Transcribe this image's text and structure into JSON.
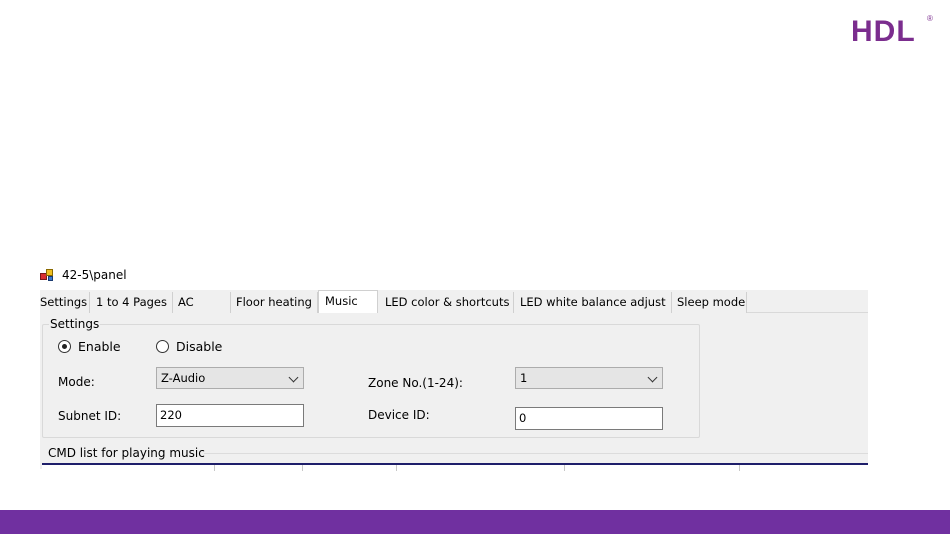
{
  "brand": {
    "logo_text": "HDL",
    "registered": "®",
    "accent_color": "#7b2d8e",
    "footer_color": "#7030a0"
  },
  "window": {
    "title": "42-5\\panel",
    "icon": "app-icon"
  },
  "tabs": [
    {
      "label": "Settings",
      "active": false
    },
    {
      "label": "1 to 4 Pages",
      "active": false
    },
    {
      "label": "AC",
      "active": false
    },
    {
      "label": "Floor heating",
      "active": false
    },
    {
      "label": "Music",
      "active": true
    },
    {
      "label": "LED color & shortcuts",
      "active": false
    },
    {
      "label": "LED white balance adjust",
      "active": false
    },
    {
      "label": "Sleep mode",
      "active": false
    }
  ],
  "settings": {
    "legend": "Settings",
    "enable_label": "Enable",
    "disable_label": "Disable",
    "selected": "Enable",
    "mode_label": "Mode:",
    "mode_value": "Z-Audio",
    "zone_label": "Zone No.(1-24):",
    "zone_value": "1",
    "subnet_label": "Subnet ID:",
    "subnet_value": "220",
    "device_label": "Device ID:",
    "device_value": "0"
  },
  "cmd_list": {
    "label": "CMD list for playing music"
  }
}
